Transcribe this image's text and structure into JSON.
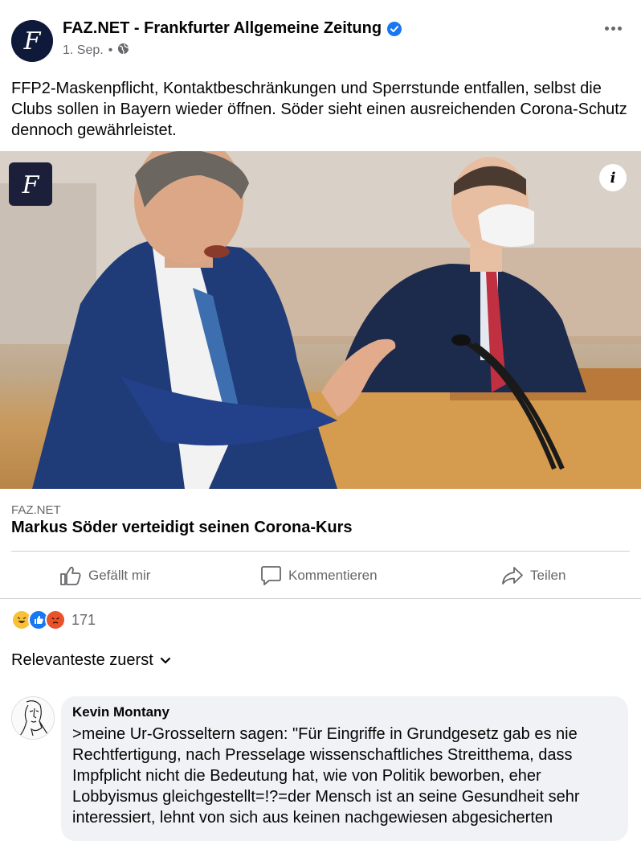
{
  "post": {
    "page_name": "FAZ.NET - Frankfurter Allgemeine Zeitung",
    "date": "1. Sep.",
    "separator": "•",
    "logo_letter": "F",
    "text": "FFP2-Maskenpflicht, Kontaktbeschränkungen und Sperrstunde entfallen, selbst die Clubs sollen in Bayern wieder öffnen. Söder sieht einen ausreichenden Corona-Schutz dennoch gewährleistet."
  },
  "image": {
    "badge_letter": "F",
    "info_label": "i"
  },
  "link": {
    "domain": "FAZ.NET",
    "title": "Markus Söder verteidigt seinen Corona-Kurs"
  },
  "actions": {
    "like": "Gefällt mir",
    "comment": "Kommentieren",
    "share": "Teilen"
  },
  "reactions": {
    "icons": [
      "haha-reaction-icon",
      "like-reaction-icon",
      "angry-reaction-icon"
    ],
    "count": "171"
  },
  "comments": {
    "sort_label": "Relevanteste zuerst",
    "items": [
      {
        "author": "Kevin Montany",
        "text": ">meine Ur-Grosseltern sagen: \"Für Eingriffe in Grundgesetz gab es nie Rechtfertigung, nach Presselage wissenschaftliches Streitthema, dass Impfplicht nicht die Bedeutung hat, wie von Politik beworben, eher Lobbyismus gleichgestellt=!?=der Mensch ist an seine Gesundheit sehr interessiert, lehnt von sich aus keinen nachgewiesen abgesicherten"
      }
    ]
  },
  "colors": {
    "brand_blue": "#1877f2",
    "text_secondary": "#65676b",
    "divider": "#ced0d4",
    "bubble": "#f0f2f5"
  }
}
